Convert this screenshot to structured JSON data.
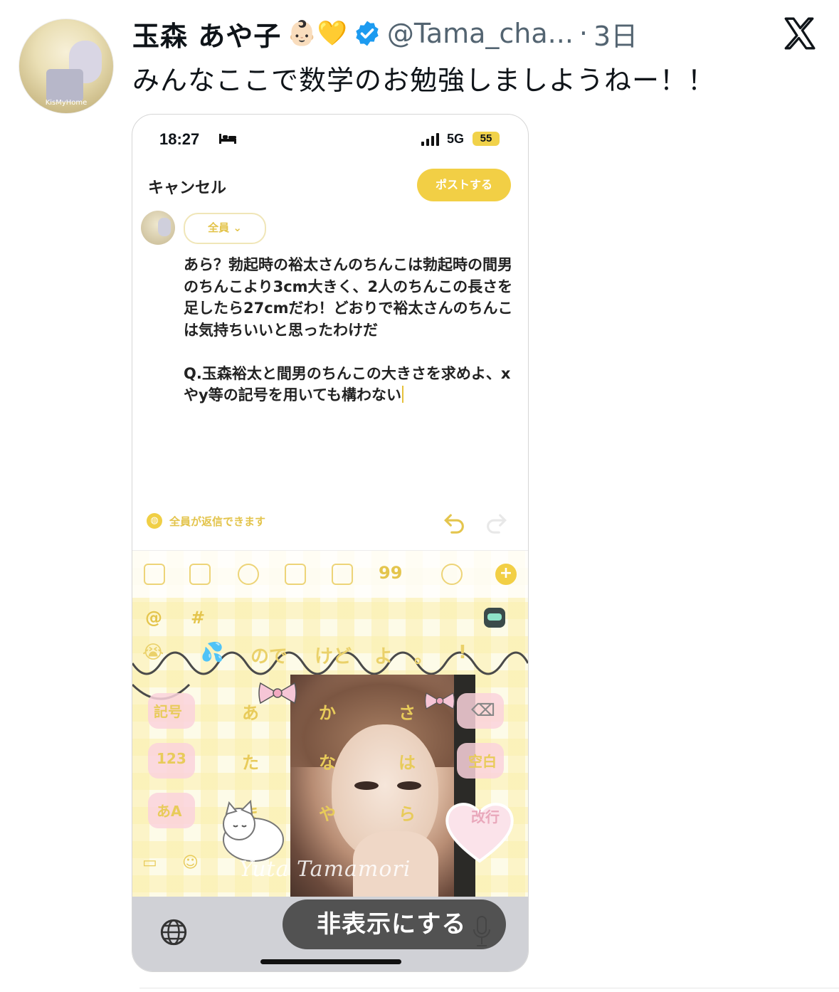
{
  "tweet": {
    "author_name": "玉森 あや子",
    "author_emoji": "👶🏻💛",
    "handle": "@Tama_cha...",
    "separator": "·",
    "time_ago": "3日",
    "text": "みんなここで数学のお勉強しましようねー！！",
    "avatar_caption": "KisMyHome"
  },
  "screenshot": {
    "status_bar": {
      "time": "18:27",
      "network": "5G",
      "battery": "55"
    },
    "cancel_label": "キャンセル",
    "post_label": "ポストする",
    "audience_label": "全員 ⌄",
    "draft_text": "あら？勃起時の裕太さんのちんこは勃起時の間男のちんこより3cm大きく、2人のちんこの長さを足したら27cmだわ！どおりで裕太さんのちんこは気持ちいいと思ったわけだ\n\nQ.玉森裕太と間男のちんこの大きさを求めよ、xやy等の記号を用いても構わない",
    "reply_setting": "全員が返信できます",
    "keyboard": {
      "symbols": [
        "@",
        "#"
      ],
      "suggestions": [
        "😭",
        "💦",
        "ので",
        "けど",
        "よ",
        "。",
        "!"
      ],
      "left_keys": [
        "記号",
        "123",
        "あA"
      ],
      "kana_keys": [
        "あ",
        "か",
        "さ",
        "た",
        "な",
        "は",
        "ま",
        "や",
        "ら"
      ],
      "right_keys": [
        "空白",
        "改行"
      ],
      "signature": "Yuta Tamamori"
    },
    "hide_keyboard_label": "非表示にする"
  },
  "colors": {
    "accent_yellow": "#f2cf45",
    "verified_blue": "#1d9bf0",
    "muted": "#536471"
  }
}
